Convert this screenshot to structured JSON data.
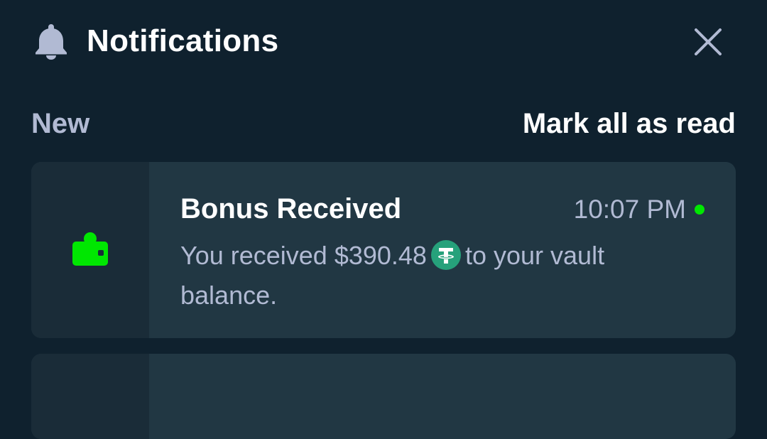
{
  "header": {
    "title": "Notifications",
    "bell_icon": "bell-icon",
    "close_icon": "close-icon"
  },
  "section": {
    "label": "New",
    "mark_all_label": "Mark all as read"
  },
  "notifications": [
    {
      "title": "Bonus Received",
      "time": "10:07 PM",
      "unread": true,
      "icon": "wallet-icon",
      "body_before": "You received $390.48",
      "currency_icon": "tether-icon",
      "body_after": "to your vault balance."
    }
  ],
  "colors": {
    "background": "#0f212e",
    "card": "#213743",
    "card_side": "#1a2c38",
    "muted_text": "#b1bad3",
    "accent_green": "#00e701",
    "tether_green": "#26a17b"
  }
}
